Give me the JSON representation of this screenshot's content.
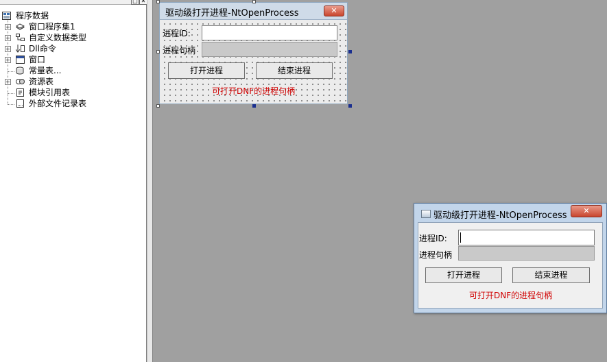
{
  "tree": {
    "root": "程序数据",
    "items": [
      {
        "label": "窗口程序集1",
        "icon": "assembly-icon"
      },
      {
        "label": "自定义数据类型",
        "icon": "datatype-icon"
      },
      {
        "label": "Dll命令",
        "icon": "dll-command-icon"
      },
      {
        "label": "窗口",
        "icon": "window-icon"
      },
      {
        "label": "常量表...",
        "icon": "constant-table-icon"
      },
      {
        "label": "资源表",
        "icon": "resource-table-icon"
      },
      {
        "label": "模块引用表",
        "icon": "module-reference-icon"
      },
      {
        "label": "外部文件记录表",
        "icon": "external-file-icon"
      }
    ]
  },
  "design_form": {
    "title": "驱动级打开进程-NtOpenProcess",
    "close": "✕",
    "pid_label": "进程ID:",
    "pid_value": "",
    "handle_label": "进程句柄",
    "handle_value": "",
    "open_button": "打开进程",
    "end_button": "结束进程",
    "hint": "可打开DNF的进程句柄"
  },
  "run_window": {
    "title": "驱动级打开进程-NtOpenProcess",
    "close": "✕",
    "pid_label": "进程ID:",
    "pid_value": "",
    "handle_label": "进程句柄",
    "handle_value": "",
    "open_button": "打开进程",
    "end_button": "结束进程",
    "hint": "可打开DNF的进程句柄"
  },
  "colors": {
    "workspace": "#a0a0a0",
    "hint_red": "#d00000",
    "close_red": "#c9462e"
  }
}
